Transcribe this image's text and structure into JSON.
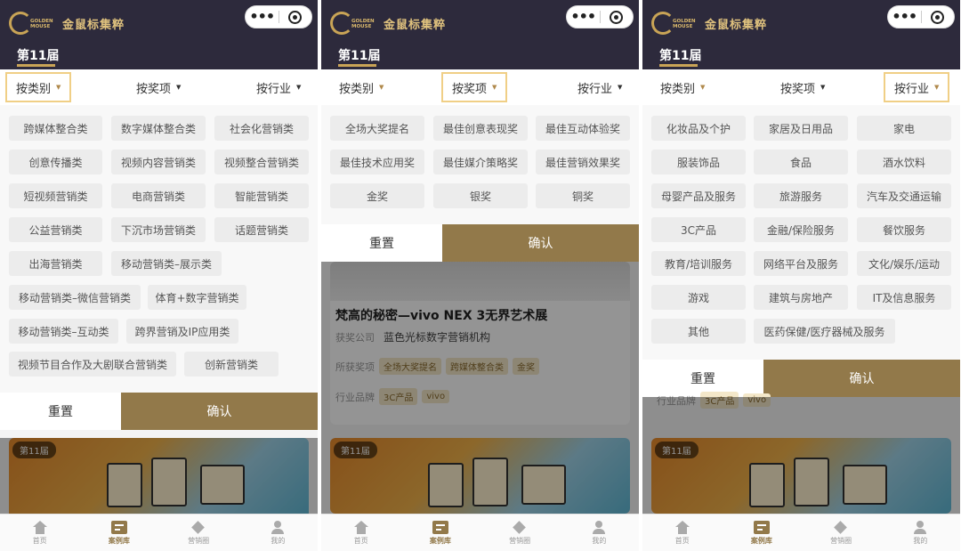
{
  "header": {
    "logo_text": "GOLDEN MOUSE",
    "brand": "金鼠标集粹",
    "session": "第11届",
    "menu_dots": "•••"
  },
  "filters": {
    "category": "按类别",
    "award": "按奖项",
    "industry": "按行业"
  },
  "panel1_options": [
    "跨媒体整合类",
    "数字媒体整合类",
    "社会化营销类",
    "创意传播类",
    "视频内容营销类",
    "视频整合营销类",
    "短视频营销类",
    "电商营销类",
    "智能营销类",
    "公益营销类",
    "下沉市场营销类",
    "话题营销类",
    "出海营销类",
    "移动营销类–展示类",
    "移动营销类–微信营销类",
    "体育+数字营销类",
    "移动营销类–互动类",
    "跨界营销及IP应用类",
    "视频节目合作及大剧联合营销类",
    "创新营销类"
  ],
  "panel2_options": [
    "全场大奖提名",
    "最佳创意表现奖",
    "最佳互动体验奖",
    "最佳技术应用奖",
    "最佳媒介策略奖",
    "最佳营销效果奖",
    "金奖",
    "银奖",
    "铜奖"
  ],
  "panel3_options": [
    "化妆品及个护",
    "家居及日用品",
    "家电",
    "服装饰品",
    "食品",
    "酒水饮料",
    "母婴产品及服务",
    "旅游服务",
    "汽车及交通运输",
    "3C产品",
    "金融/保险服务",
    "餐饮服务",
    "教育/培训服务",
    "网络平台及服务",
    "文化/娱乐/运动",
    "游戏",
    "建筑与房地产",
    "IT及信息服务",
    "其他",
    "医药保健/医疗器械及服务"
  ],
  "buttons": {
    "reset": "重置",
    "confirm": "确认"
  },
  "case": {
    "title": "梵高的秘密—vivo NEX 3无界艺术展",
    "company_label": "获奖公司",
    "company": "蓝色光标数字营销机构",
    "awards_label": "所获奖项",
    "awards": [
      "全场大奖提名",
      "跨媒体整合类",
      "金奖"
    ],
    "industry_label": "行业品牌",
    "industry": [
      "3C产品",
      "vivo"
    ]
  },
  "card_badge": "第11届",
  "tabbar": {
    "home": "首页",
    "cases": "案例库",
    "circle": "营销圈",
    "mine": "我的"
  },
  "colors": {
    "header_bg": "#2d2a3c",
    "gold": "#92794a",
    "active_border": "#f0cf86"
  }
}
